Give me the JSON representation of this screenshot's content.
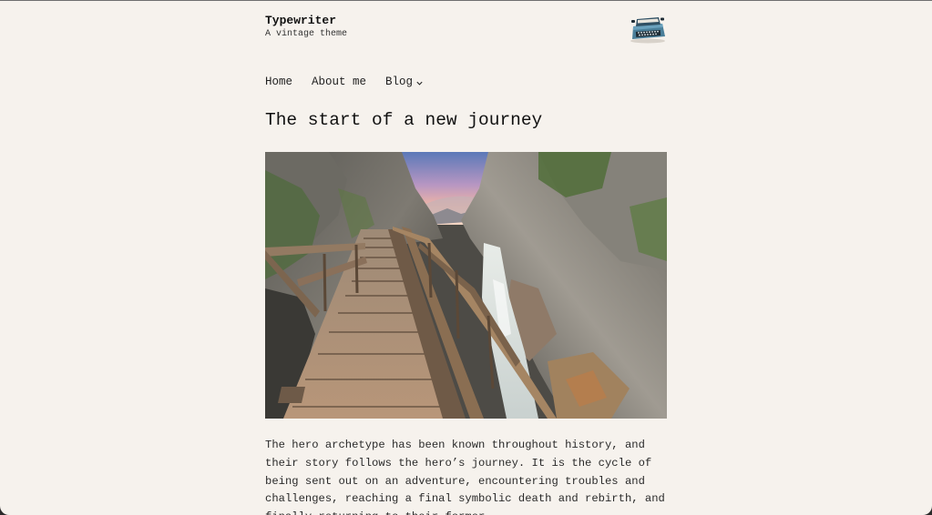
{
  "site": {
    "title": "Typewriter",
    "tagline": "A vintage theme",
    "logo_icon": "typewriter-icon"
  },
  "nav": {
    "items": [
      {
        "label": "Home"
      },
      {
        "label": "About me"
      },
      {
        "label": "Blog",
        "icon": "chevron-down-icon"
      }
    ]
  },
  "post": {
    "title": "The start of a new journey",
    "image_icon": "wooden-stairway-canyon-photo",
    "body": "The hero archetype has been known throughout history, and their story follows the hero’s journey. It is the cycle of being sent out on an adventure, encountering troubles and challenges, reaching a final symbolic death and rebirth, and finally returning to their former"
  },
  "colors": {
    "background": "#f6f2ed",
    "text": "#2a2a2a",
    "heading": "#111111"
  }
}
